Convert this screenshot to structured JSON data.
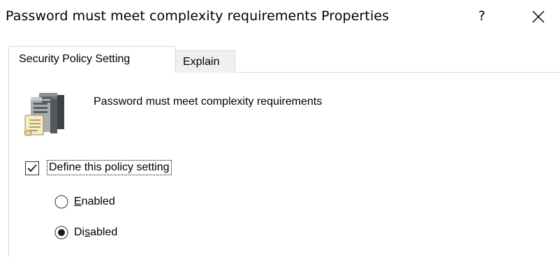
{
  "window": {
    "title": "Password must meet complexity requirements Properties",
    "help_label": "?",
    "close_icon": "close-icon"
  },
  "tabs": [
    {
      "label": "Security Policy Setting",
      "selected": true
    },
    {
      "label": "Explain",
      "selected": false
    }
  ],
  "policy": {
    "icon": "server-policy-icon",
    "name": "Password must meet complexity requirements"
  },
  "define_setting": {
    "label": "Define this policy setting",
    "checked": true
  },
  "options": {
    "enabled": {
      "label_before": "",
      "label_mnemonic": "E",
      "label_after": "nabled",
      "selected": false
    },
    "disabled": {
      "label_before": "Di",
      "label_mnemonic": "s",
      "label_after": "abled",
      "selected": true
    }
  },
  "colors": {
    "border": "#d9d9d9",
    "inactive_tab": "#f0f0f0",
    "text": "#000000"
  }
}
